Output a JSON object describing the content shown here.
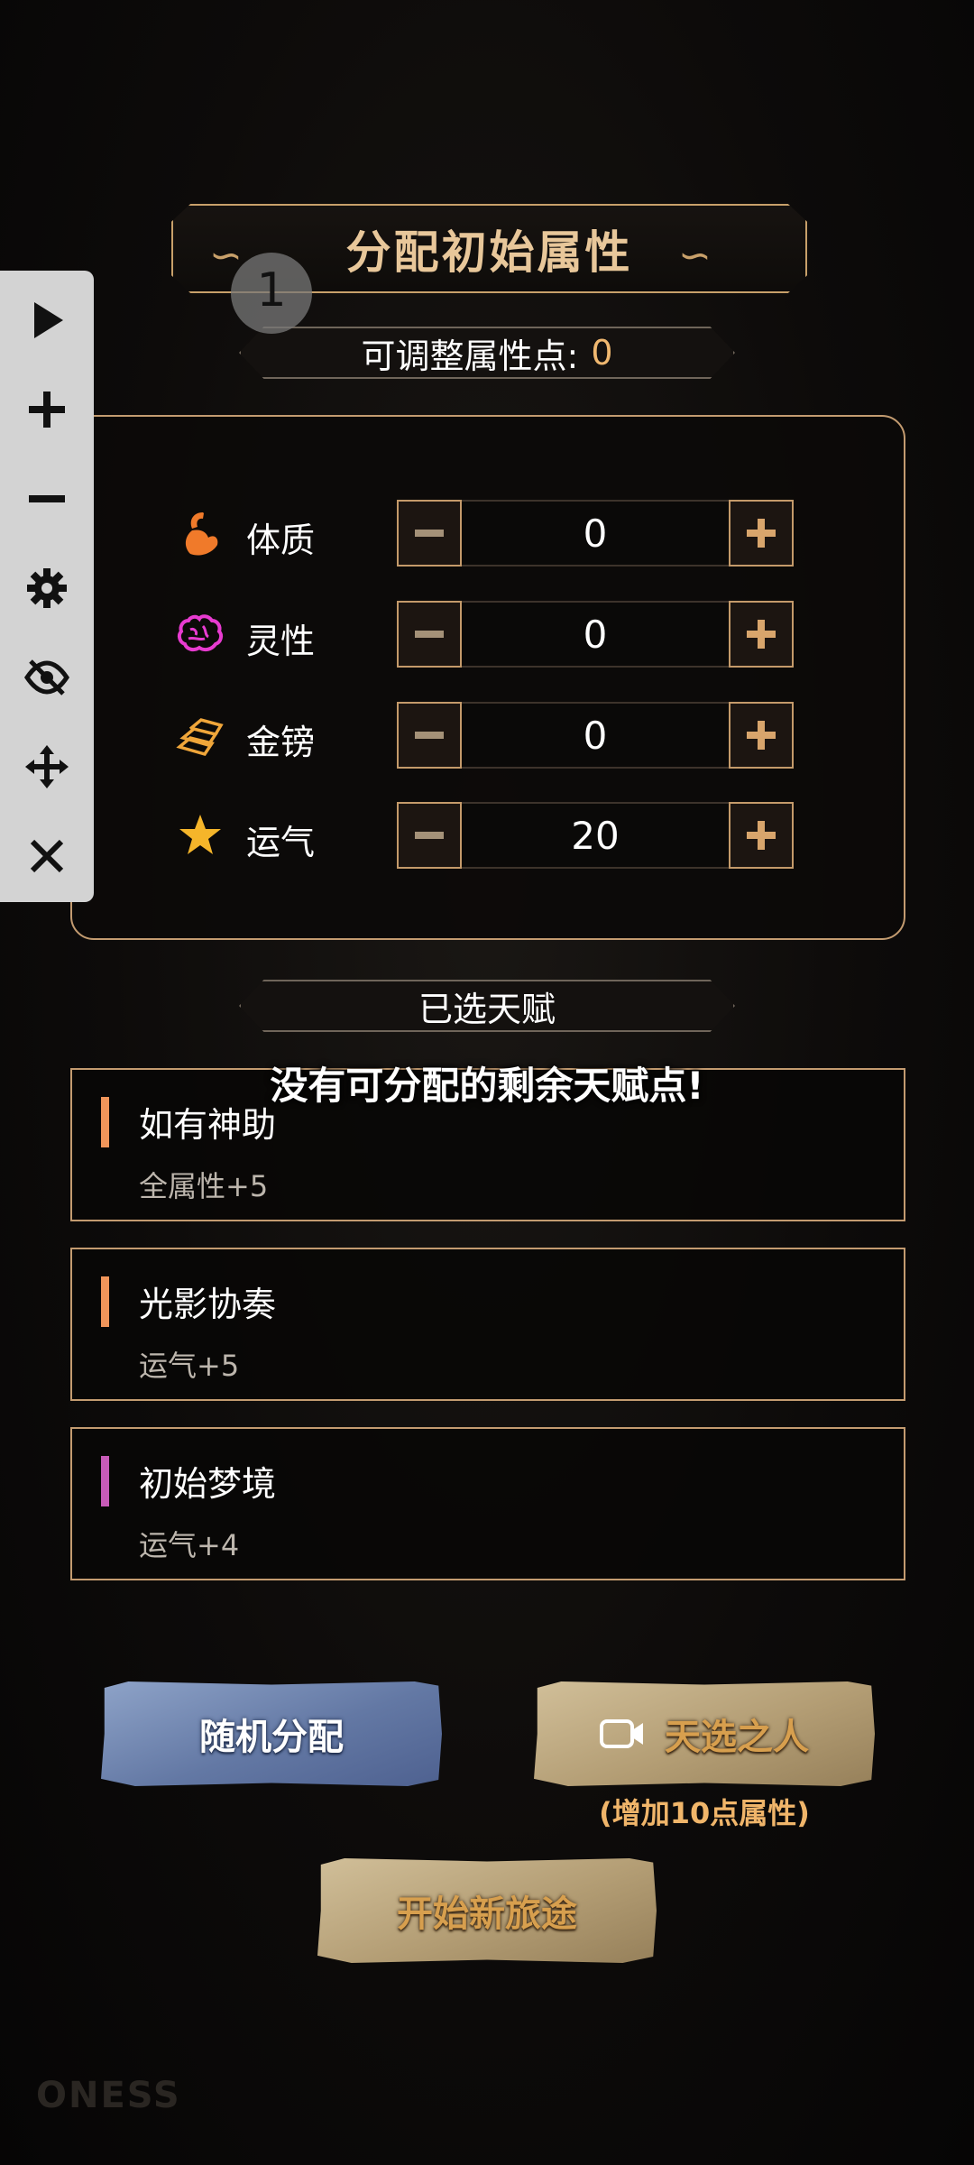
{
  "title": "分配初始属性",
  "points": {
    "label": "可调整属性点:",
    "value": "0"
  },
  "attributes": [
    {
      "icon": "flexed-bicep-icon",
      "label": "体质",
      "value": "0"
    },
    {
      "icon": "brain-icon",
      "label": "灵性",
      "value": "0"
    },
    {
      "icon": "gold-bars-icon",
      "label": "金镑",
      "value": "0"
    },
    {
      "icon": "star-icon",
      "label": "运气",
      "value": "20"
    }
  ],
  "talents_header": "已选天赋",
  "toast": "没有可分配的剩余天赋点!",
  "talents": [
    {
      "name": "如有神助",
      "desc": "全属性+5",
      "color": "#f0955a"
    },
    {
      "name": "光影协奏",
      "desc": "运气+5",
      "color": "#f0955a"
    },
    {
      "name": "初始梦境",
      "desc": "运气+4",
      "color": "#c85bb8"
    }
  ],
  "buttons": {
    "random": "随机分配",
    "chosen": "天选之人",
    "chosen_sub": "(增加10点属性)",
    "start": "开始新旅途"
  },
  "toolbar": {
    "icons": [
      "play-icon",
      "plus-icon",
      "minus-icon",
      "gear-icon",
      "eye-off-icon",
      "move-icon",
      "close-icon"
    ]
  },
  "crosshair": {
    "number": "1"
  },
  "watermark": "ONESS",
  "colors": {
    "accent_gold": "#c8a06a",
    "points_value": "#f0b870",
    "random_button": "#6378a4",
    "stone_button": "#b39d74"
  }
}
